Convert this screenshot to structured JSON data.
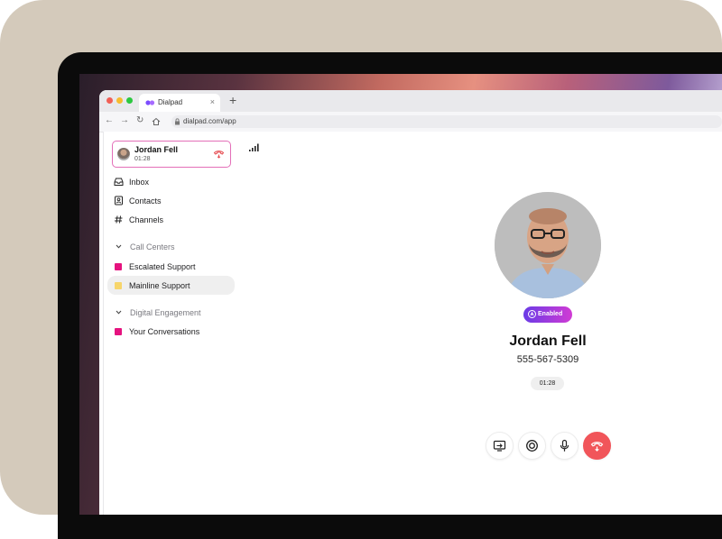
{
  "browser": {
    "tab_title": "Dialpad",
    "tab_close": "×",
    "new_tab": "+",
    "url": "dialpad.com/app"
  },
  "active_call": {
    "name": "Jordan Fell",
    "duration": "01:28"
  },
  "sidebar": {
    "items": [
      {
        "label": "Inbox",
        "icon": "inbox-icon"
      },
      {
        "label": "Contacts",
        "icon": "contacts-icon"
      },
      {
        "label": "Channels",
        "icon": "hash-icon"
      }
    ],
    "call_centers": {
      "heading": "Call Centers",
      "items": [
        {
          "label": "Escalated Support",
          "color": "#e5137f"
        },
        {
          "label": "Mainline Support",
          "color": "#f7d56a"
        }
      ]
    },
    "digital_engagement": {
      "heading": "Digital Engagement",
      "items": [
        {
          "label": "Your Conversations",
          "color": "#e5137f"
        }
      ]
    }
  },
  "contact": {
    "badge": "Enabled",
    "name": "Jordan Fell",
    "number": "555-567-5309",
    "timer": "01:28"
  },
  "colors": {
    "accent": "#e36fb8",
    "hangup": "#f1555a",
    "badge_start": "#6a3be6",
    "badge_end": "#d13bd4"
  }
}
